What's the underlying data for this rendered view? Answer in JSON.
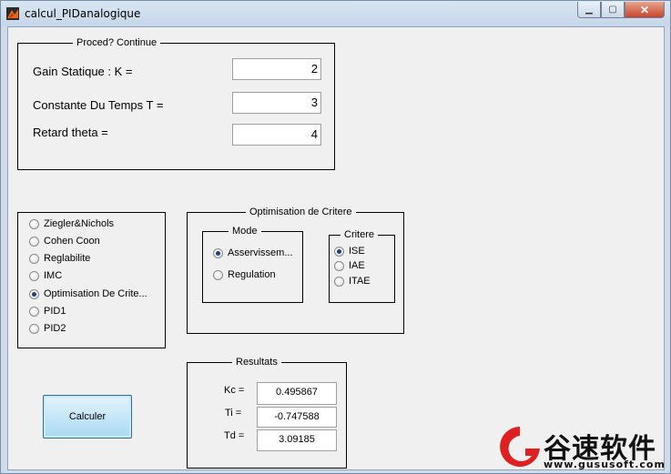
{
  "window": {
    "title": "calcul_PIDanalogique",
    "minimize_glyph": "▁",
    "maximize_glyph": "▢",
    "close_glyph": "✕"
  },
  "params": {
    "title": "Proced? Continue",
    "k_label": "Gain Statique : K =",
    "k_value": "2",
    "t_label": "Constante Du Temps T =",
    "t_value": "3",
    "theta_label": "Retard theta =",
    "theta_value": "4"
  },
  "methods": {
    "items": [
      {
        "label": "Ziegler&Nichols",
        "selected": false
      },
      {
        "label": "Cohen Coon",
        "selected": false
      },
      {
        "label": "Reglabilite",
        "selected": false
      },
      {
        "label": "IMC",
        "selected": false
      },
      {
        "label": "Optimisation De Crite...",
        "selected": true
      },
      {
        "label": "PID1",
        "selected": false
      },
      {
        "label": "PID2",
        "selected": false
      }
    ]
  },
  "optim": {
    "title": "Optimisation de Critere",
    "mode": {
      "title": "Mode",
      "options": [
        {
          "label": "Asservissem...",
          "selected": true
        },
        {
          "label": "Regulation",
          "selected": false
        }
      ]
    },
    "critere": {
      "title": "Critere",
      "options": [
        {
          "label": "ISE",
          "selected": true
        },
        {
          "label": "IAE",
          "selected": false
        },
        {
          "label": "ITAE",
          "selected": false
        }
      ]
    }
  },
  "results": {
    "title": "Resultats",
    "kc_label": "Kc =",
    "kc_value": "0.495867",
    "ti_label": "Ti =",
    "ti_value": "-0.747588",
    "td_label": "Td =",
    "td_value": "3.09185"
  },
  "calculer_label": "Calculer",
  "watermark": {
    "text": "谷速软件",
    "url": "www.gususoft.com",
    "color": "#e02020"
  }
}
